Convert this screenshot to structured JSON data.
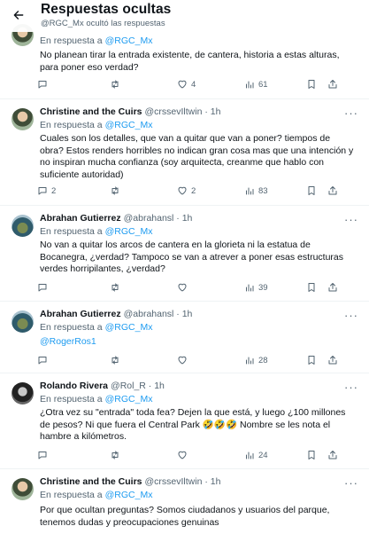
{
  "header": {
    "title": "Respuestas ocultas",
    "subtitle": "@RGC_Mx ocultó las respuestas"
  },
  "tweets": [
    {
      "name": "",
      "handle": "",
      "time": "",
      "reply_label": "En respuesta a",
      "reply_to": "@RGC_Mx",
      "text": "No planean tirar la entrada existente, de cantera, historia a estas alturas, para poner eso verdad?",
      "replies": "",
      "retweets": "",
      "likes": "4",
      "views": "61"
    },
    {
      "name": "Christine and the Cuirs",
      "handle": "@crssevIltwin · 1h",
      "reply_label": "En respuesta a",
      "reply_to": "@RGC_Mx",
      "text": "Cuales son los detalles, que van a quitar que van a poner? tiempos de obra? Estos renders horribles no indican gran cosa mas que una intención y no inspiran mucha confianza (soy arquitecta, creanme que hablo con suficiente autoridad)",
      "replies": "2",
      "retweets": "",
      "likes": "2",
      "views": "83"
    },
    {
      "name": "Abrahan Gutierrez",
      "handle": "@abrahansl · 1h",
      "reply_label": "En respuesta a",
      "reply_to": "@RGC_Mx",
      "text": "No van a quitar los arcos de cantera en la glorieta ni la estatua de Bocanegra, ¿verdad? Tampoco se van a atrever a poner esas estructuras verdes horripilantes, ¿verdad?",
      "replies": "",
      "retweets": "",
      "likes": "",
      "views": "39"
    },
    {
      "name": "Abrahan Gutierrez",
      "handle": "@abrahansl · 1h",
      "reply_label": "En respuesta a",
      "reply_to": "@RGC_Mx",
      "text": "@RogerRos1",
      "replies": "",
      "retweets": "",
      "likes": "",
      "views": "28"
    },
    {
      "name": "Rolando Rivera",
      "handle": "@Rol_R · 1h",
      "reply_label": "En respuesta a",
      "reply_to": "@RGC_Mx",
      "text": "¿Otra vez su \"entrada\" toda fea? Dejen la que está, y luego ¿100 millones de pesos? Ni que fuera el Central Park 🤣🤣🤣 Nombre se les nota el hambre a kilómetros.",
      "replies": "",
      "retweets": "",
      "likes": "",
      "views": "24"
    },
    {
      "name": "Christine and the Cuirs",
      "handle": "@crssevIltwin · 1h",
      "reply_label": "En respuesta a",
      "reply_to": "@RGC_Mx",
      "text": "Por que ocultan preguntas? Somos ciudadanos y usuarios del parque, tenemos dudas y preocupaciones genuinas",
      "replies": "",
      "retweets": "",
      "likes": "",
      "views": ""
    }
  ],
  "icons": {
    "back": "arrow-left-icon",
    "more": "more-dots-icon",
    "reply": "comment-icon",
    "retweet": "retweet-icon",
    "like": "heart-icon",
    "views": "views-bars-icon",
    "bookmark": "bookmark-icon",
    "share": "share-icon"
  },
  "colors": {
    "accent": "#1d9bf0",
    "text": "#0f1419",
    "muted": "#536471",
    "divider": "#eff3f4"
  }
}
